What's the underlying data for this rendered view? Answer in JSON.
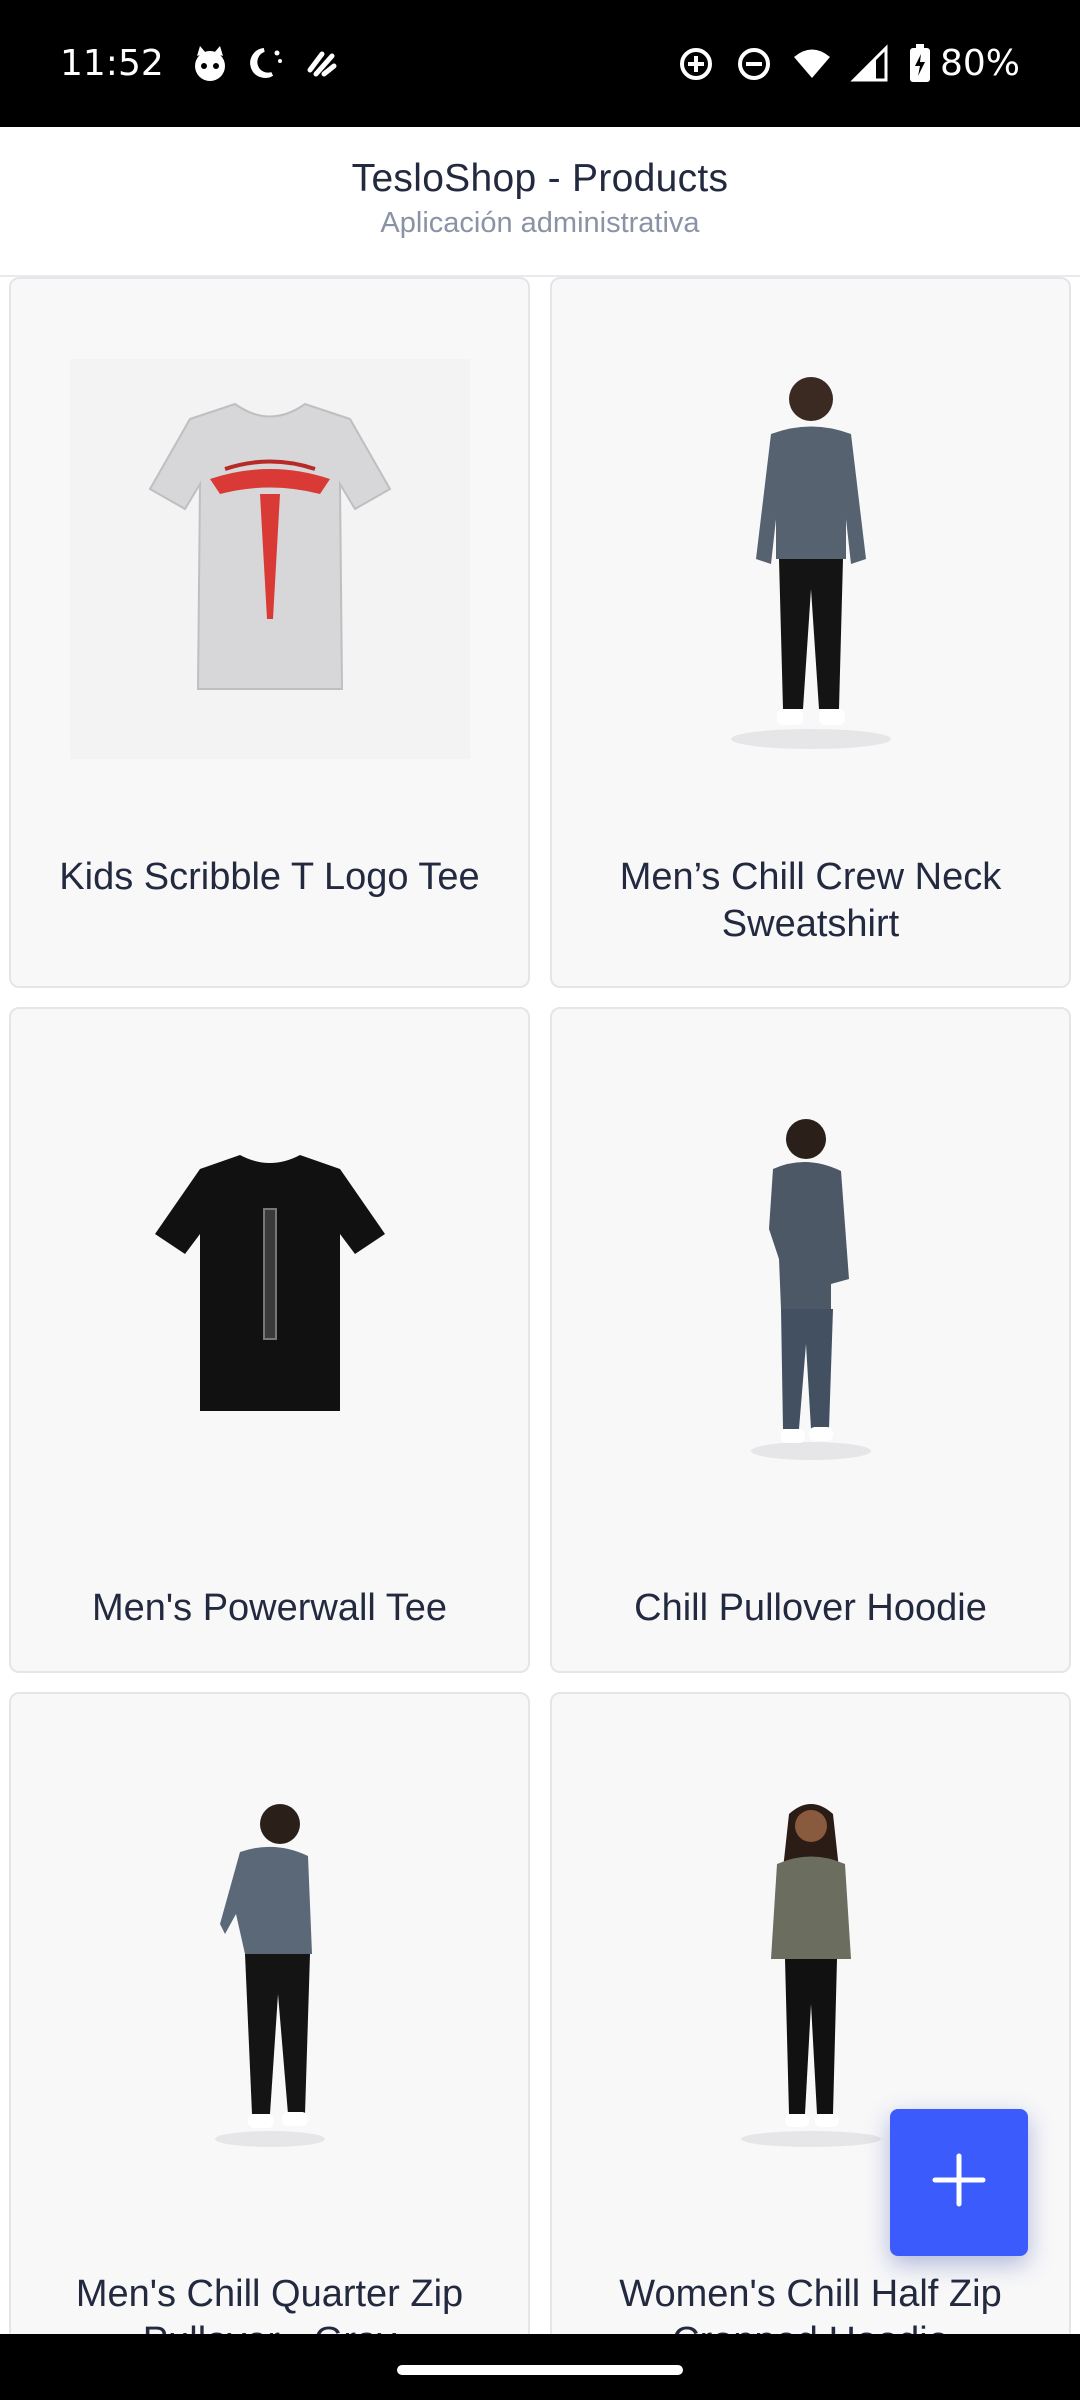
{
  "status_bar": {
    "time": "11:52",
    "battery": "80%",
    "left_icons": [
      "cat-face-icon",
      "moon-night-icon",
      "app-logo-icon"
    ],
    "right_icons": [
      "data-saver-icon",
      "do-not-disturb-icon",
      "wifi-icon",
      "signal-icon",
      "battery-charging-icon"
    ]
  },
  "header": {
    "title": "TesloShop - Products",
    "subtitle": "Aplicación administrativa"
  },
  "products": [
    {
      "name": "Kids Scribble T Logo Tee",
      "image": "kids-tee-image"
    },
    {
      "name": "Men’s Chill Crew Neck Sweatshirt",
      "image": "crew-neck-sweatshirt-image"
    },
    {
      "name": "Men's Powerwall Tee",
      "image": "powerwall-tee-image"
    },
    {
      "name": "Chill Pullover Hoodie",
      "image": "pullover-hoodie-image"
    },
    {
      "name": "Men's Chill Quarter Zip Pullover - Gray",
      "image": "quarter-zip-pullover-image"
    },
    {
      "name": "Women's Chill Half Zip Cropped Hoodie",
      "image": "half-zip-cropped-hoodie-image"
    }
  ],
  "fab": {
    "icon": "plus-icon",
    "color": "#3b5bfd"
  },
  "colors": {
    "accent": "#3b5bfd",
    "card_bg": "#f8f8f9",
    "text": "#232a3f",
    "subtitle": "#8a93a6"
  }
}
